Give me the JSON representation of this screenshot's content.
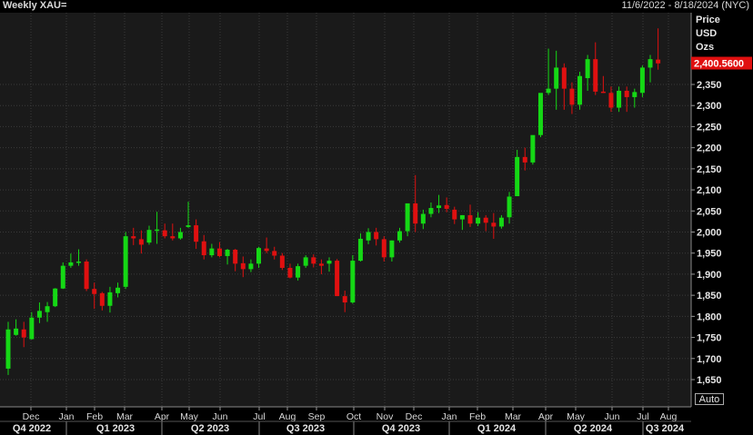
{
  "header": {
    "title": "Weekly XAU=",
    "date_range": "11/6/2022 - 8/18/2024 (NYC)"
  },
  "axis_header": [
    "Price",
    "USD",
    "Ozs"
  ],
  "auto_label": "Auto",
  "colors": {
    "up": "#15d815",
    "down": "#e01010",
    "grid": "#3a3a3a",
    "background": "#1a1a1a",
    "last_price_bg": "#e01010"
  },
  "chart_data": {
    "type": "candlestick",
    "title": "Weekly XAU=",
    "ylabel": "Price USD Ozs",
    "ylim": [
      1600,
      2480
    ],
    "y_ticks": [
      1650,
      1700,
      1750,
      1800,
      1850,
      1900,
      1950,
      2000,
      2050,
      2100,
      2150,
      2200,
      2250,
      2300,
      2350
    ],
    "y_tick_labels": [
      "1,650",
      "1,700",
      "1,750",
      "1,800",
      "1,850",
      "1,900",
      "1,950",
      "2,000",
      "2,050",
      "2,100",
      "2,150",
      "2,200",
      "2,250",
      "2,300",
      "2,350"
    ],
    "last_price": 2400.56,
    "last_price_label": "2,400.5600",
    "month_labels": [
      "Dec",
      "Jan",
      "Feb",
      "Mar",
      "Apr",
      "May",
      "Jun",
      "Jul",
      "Aug",
      "Sep",
      "Oct",
      "Nov",
      "Dec",
      "Jan",
      "Feb",
      "Mar",
      "Apr",
      "May",
      "Jun",
      "Jul",
      "Aug"
    ],
    "quarter_labels": [
      "Q4 2022",
      "Q1 2023",
      "Q2 2023",
      "Q3 2023",
      "Q4 2023",
      "Q1 2024",
      "Q2 2024",
      "Q3 2024"
    ],
    "candles": [
      {
        "o": 1676,
        "h": 1787,
        "l": 1661,
        "c": 1769
      },
      {
        "o": 1756,
        "h": 1793,
        "l": 1754,
        "c": 1771
      },
      {
        "o": 1769,
        "h": 1787,
        "l": 1727,
        "c": 1750
      },
      {
        "o": 1746,
        "h": 1810,
        "l": 1745,
        "c": 1797
      },
      {
        "o": 1797,
        "h": 1833,
        "l": 1784,
        "c": 1813
      },
      {
        "o": 1810,
        "h": 1834,
        "l": 1787,
        "c": 1824
      },
      {
        "o": 1824,
        "h": 1867,
        "l": 1822,
        "c": 1866
      },
      {
        "o": 1866,
        "h": 1928,
        "l": 1865,
        "c": 1920
      },
      {
        "o": 1920,
        "h": 1949,
        "l": 1915,
        "c": 1928
      },
      {
        "o": 1928,
        "h": 1959,
        "l": 1920,
        "c": 1930
      },
      {
        "o": 1930,
        "h": 1935,
        "l": 1860,
        "c": 1865
      },
      {
        "o": 1865,
        "h": 1880,
        "l": 1818,
        "c": 1853
      },
      {
        "o": 1855,
        "h": 1858,
        "l": 1814,
        "c": 1825
      },
      {
        "o": 1825,
        "h": 1870,
        "l": 1809,
        "c": 1857
      },
      {
        "o": 1855,
        "h": 1880,
        "l": 1845,
        "c": 1868
      },
      {
        "o": 1870,
        "h": 2000,
        "l": 1865,
        "c": 1990
      },
      {
        "o": 1990,
        "h": 2010,
        "l": 1969,
        "c": 1985
      },
      {
        "o": 1983,
        "h": 2004,
        "l": 1949,
        "c": 1970
      },
      {
        "o": 1975,
        "h": 2015,
        "l": 1970,
        "c": 2005
      },
      {
        "o": 2005,
        "h": 2048,
        "l": 1972,
        "c": 2006
      },
      {
        "o": 2004,
        "h": 2020,
        "l": 1985,
        "c": 1990
      },
      {
        "o": 1990,
        "h": 2020,
        "l": 1980,
        "c": 1985
      },
      {
        "o": 1985,
        "h": 2010,
        "l": 1982,
        "c": 2000
      },
      {
        "o": 2012,
        "h": 2072,
        "l": 2010,
        "c": 2016
      },
      {
        "o": 2016,
        "h": 2030,
        "l": 1960,
        "c": 1977
      },
      {
        "o": 1978,
        "h": 1993,
        "l": 1935,
        "c": 1945
      },
      {
        "o": 1945,
        "h": 1972,
        "l": 1940,
        "c": 1961
      },
      {
        "o": 1961,
        "h": 1976,
        "l": 1940,
        "c": 1943
      },
      {
        "o": 1943,
        "h": 1960,
        "l": 1923,
        "c": 1958
      },
      {
        "o": 1958,
        "h": 1960,
        "l": 1907,
        "c": 1925
      },
      {
        "o": 1926,
        "h": 1942,
        "l": 1893,
        "c": 1912
      },
      {
        "o": 1912,
        "h": 1935,
        "l": 1905,
        "c": 1925
      },
      {
        "o": 1925,
        "h": 1965,
        "l": 1915,
        "c": 1962
      },
      {
        "o": 1961,
        "h": 1987,
        "l": 1950,
        "c": 1955
      },
      {
        "o": 1955,
        "h": 1965,
        "l": 1935,
        "c": 1944
      },
      {
        "o": 1944,
        "h": 1950,
        "l": 1910,
        "c": 1915
      },
      {
        "o": 1915,
        "h": 1925,
        "l": 1890,
        "c": 1892
      },
      {
        "o": 1892,
        "h": 1925,
        "l": 1885,
        "c": 1919
      },
      {
        "o": 1920,
        "h": 1945,
        "l": 1915,
        "c": 1940
      },
      {
        "o": 1940,
        "h": 1947,
        "l": 1916,
        "c": 1925
      },
      {
        "o": 1925,
        "h": 1935,
        "l": 1900,
        "c": 1920
      },
      {
        "o": 1925,
        "h": 1940,
        "l": 1906,
        "c": 1932
      },
      {
        "o": 1932,
        "h": 1936,
        "l": 1848,
        "c": 1848
      },
      {
        "o": 1848,
        "h": 1861,
        "l": 1810,
        "c": 1833
      },
      {
        "o": 1833,
        "h": 1945,
        "l": 1830,
        "c": 1932
      },
      {
        "o": 1932,
        "h": 1997,
        "l": 1930,
        "c": 1984
      },
      {
        "o": 1980,
        "h": 2009,
        "l": 1971,
        "c": 2000
      },
      {
        "o": 2000,
        "h": 2010,
        "l": 1968,
        "c": 1983
      },
      {
        "o": 1983,
        "h": 1990,
        "l": 1930,
        "c": 1940
      },
      {
        "o": 1940,
        "h": 1980,
        "l": 1930,
        "c": 1980
      },
      {
        "o": 1980,
        "h": 2010,
        "l": 1975,
        "c": 2002
      },
      {
        "o": 2002,
        "h": 2065,
        "l": 1990,
        "c": 2068
      },
      {
        "o": 2068,
        "h": 2135,
        "l": 2000,
        "c": 2020
      },
      {
        "o": 2020,
        "h": 2053,
        "l": 2007,
        "c": 2043
      },
      {
        "o": 2043,
        "h": 2070,
        "l": 2035,
        "c": 2057
      },
      {
        "o": 2057,
        "h": 2088,
        "l": 2045,
        "c": 2063
      },
      {
        "o": 2064,
        "h": 2082,
        "l": 2047,
        "c": 2055
      },
      {
        "o": 2053,
        "h": 2060,
        "l": 2019,
        "c": 2030
      },
      {
        "o": 2030,
        "h": 2040,
        "l": 2005,
        "c": 2040
      },
      {
        "o": 2040,
        "h": 2065,
        "l": 2012,
        "c": 2020
      },
      {
        "o": 2020,
        "h": 2047,
        "l": 2014,
        "c": 2034
      },
      {
        "o": 2034,
        "h": 2040,
        "l": 2002,
        "c": 2022
      },
      {
        "o": 2022,
        "h": 2045,
        "l": 1984,
        "c": 2013
      },
      {
        "o": 2013,
        "h": 2040,
        "l": 2008,
        "c": 2034
      },
      {
        "o": 2035,
        "h": 2095,
        "l": 2020,
        "c": 2084
      },
      {
        "o": 2085,
        "h": 2195,
        "l": 2085,
        "c": 2178
      },
      {
        "o": 2178,
        "h": 2200,
        "l": 2146,
        "c": 2165
      },
      {
        "o": 2165,
        "h": 2220,
        "l": 2160,
        "c": 2230
      },
      {
        "o": 2230,
        "h": 2265,
        "l": 2225,
        "c": 2330
      },
      {
        "o": 2330,
        "h": 2435,
        "l": 2325,
        "c": 2340
      },
      {
        "o": 2340,
        "h": 2430,
        "l": 2290,
        "c": 2390
      },
      {
        "o": 2390,
        "h": 2400,
        "l": 2290,
        "c": 2340
      },
      {
        "o": 2340,
        "h": 2355,
        "l": 2280,
        "c": 2302
      },
      {
        "o": 2302,
        "h": 2380,
        "l": 2290,
        "c": 2370
      },
      {
        "o": 2365,
        "h": 2420,
        "l": 2335,
        "c": 2410
      },
      {
        "o": 2410,
        "h": 2450,
        "l": 2325,
        "c": 2333
      },
      {
        "o": 2333,
        "h": 2370,
        "l": 2330,
        "c": 2330
      },
      {
        "o": 2330,
        "h": 2345,
        "l": 2285,
        "c": 2295
      },
      {
        "o": 2295,
        "h": 2345,
        "l": 2285,
        "c": 2335
      },
      {
        "o": 2335,
        "h": 2345,
        "l": 2285,
        "c": 2320
      },
      {
        "o": 2320,
        "h": 2340,
        "l": 2295,
        "c": 2332
      },
      {
        "o": 2330,
        "h": 2395,
        "l": 2320,
        "c": 2390
      },
      {
        "o": 2390,
        "h": 2420,
        "l": 2355,
        "c": 2410
      },
      {
        "o": 2409,
        "h": 2483,
        "l": 2385,
        "c": 2400
      }
    ]
  }
}
